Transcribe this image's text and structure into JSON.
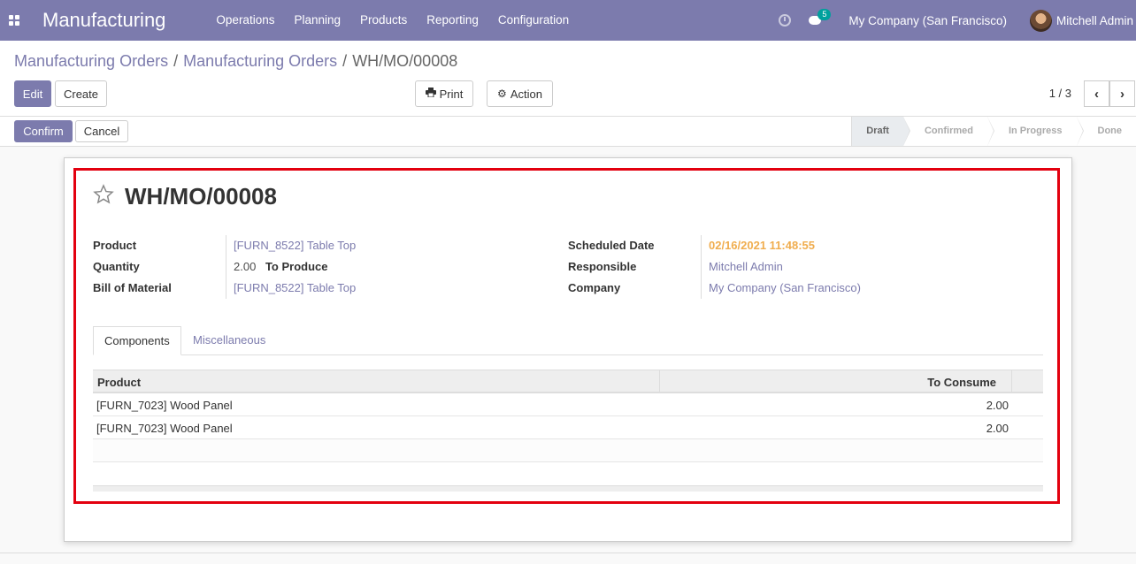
{
  "navbar": {
    "app_title": "Manufacturing",
    "menu": [
      "Operations",
      "Planning",
      "Products",
      "Reporting",
      "Configuration"
    ],
    "chat_count": "5",
    "company": "My Company (San Francisco)",
    "user": "Mitchell Admin"
  },
  "breadcrumb": [
    "Manufacturing Orders",
    "Manufacturing Orders",
    "WH/MO/00008"
  ],
  "toolbar": {
    "edit": "Edit",
    "create": "Create",
    "print": "Print",
    "action": "Action",
    "pager": "1 / 3"
  },
  "statusbar": {
    "confirm": "Confirm",
    "cancel": "Cancel",
    "stages": [
      "Draft",
      "Confirmed",
      "In Progress",
      "Done"
    ],
    "current_stage": "Draft"
  },
  "record": {
    "name": "WH/MO/00008",
    "left_fields": [
      {
        "label": "Product",
        "value": "[FURN_8522] Table Top"
      },
      {
        "label": "Quantity",
        "value": "2.00",
        "suffix": "To Produce"
      },
      {
        "label": "Bill of Material",
        "value": "[FURN_8522] Table Top"
      }
    ],
    "right_fields": [
      {
        "label": "Scheduled Date",
        "value": "02/16/2021 11:48:55"
      },
      {
        "label": "Responsible",
        "value": "Mitchell Admin"
      },
      {
        "label": "Company",
        "value": "My Company (San Francisco)"
      }
    ]
  },
  "tabs": [
    "Components",
    "Miscellaneous"
  ],
  "components": {
    "headers": {
      "product": "Product",
      "to_consume": "To Consume"
    },
    "rows": [
      {
        "product": "[FURN_7023] Wood Panel",
        "to_consume": "2.00"
      },
      {
        "product": "[FURN_7023] Wood Panel",
        "to_consume": "2.00"
      }
    ]
  },
  "colors": {
    "primary": "#7c7bad",
    "highlight": "#e3000f",
    "warning": "#f0ad4e"
  }
}
